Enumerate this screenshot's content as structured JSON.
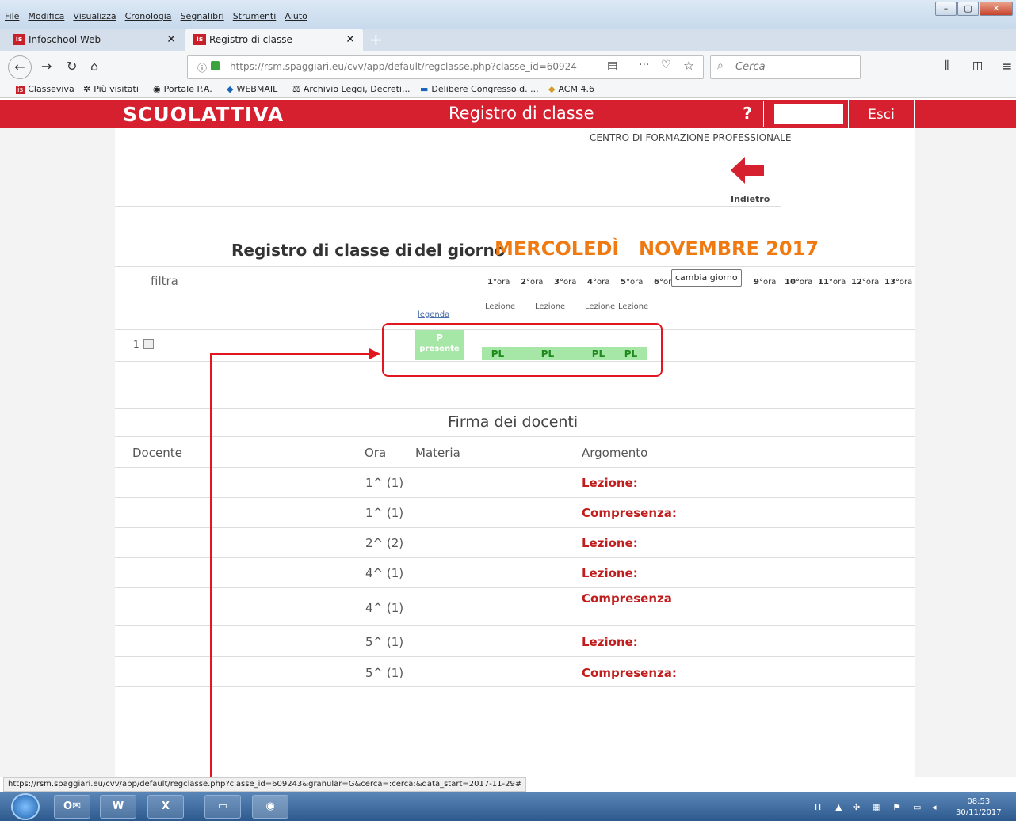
{
  "browser": {
    "menu": [
      "File",
      "Modifica",
      "Visualizza",
      "Cronologia",
      "Segnalibri",
      "Strumenti",
      "Aiuto"
    ],
    "tabs": [
      {
        "label": "Infoschool Web",
        "favicon": "is"
      },
      {
        "label": "Registro di classe",
        "favicon": "is"
      }
    ],
    "url": "https://rsm.spaggiari.eu/cvv/app/default/regclasse.php?classe_id=60924",
    "search_placeholder": "Cerca",
    "bookmarks": [
      "Classeviva",
      "Più visitati",
      "Portale P.A.",
      "WEBMAIL",
      "Archivio Leggi, Decreti...",
      "Delibere Congresso d. ...",
      "ACM 4.6"
    ],
    "status_url": "https://rsm.spaggiari.eu/cvv/app/default/regclasse.php?classe_id=609243&granular=G&cerca=:cerca:&data_start=2017-11-29#"
  },
  "header": {
    "logo": "SCUOLATTIVA",
    "title": "Registro di classe",
    "help": "?",
    "logout": "Esci"
  },
  "page": {
    "school": "CENTRO DI FORMAZIONE PROFESSIONALE",
    "back_label": "Indietro",
    "title_prefix": "Registro di classe di",
    "title_day_label": "del giorno",
    "weekday": "MERCOLEDÌ",
    "month_year": "NOVEMBRE 2017",
    "filter_label": "filtra",
    "hours": [
      {
        "n": "1°",
        "s": "ora"
      },
      {
        "n": "2°",
        "s": "ora"
      },
      {
        "n": "3°",
        "s": "ora"
      },
      {
        "n": "4°",
        "s": "ora"
      },
      {
        "n": "5°",
        "s": "ora"
      },
      {
        "n": "6°",
        "s": "or"
      },
      {
        "n": "9°",
        "s": "ora"
      },
      {
        "n": "10°",
        "s": "ora"
      },
      {
        "n": "11°",
        "s": "ora"
      },
      {
        "n": "12°",
        "s": "ora"
      },
      {
        "n": "13°",
        "s": "ora"
      }
    ],
    "tooltip": "cambia giorno",
    "lesson_labels": [
      "Lezione",
      "Lezione",
      "Lezione",
      "Lezione"
    ],
    "legend_link": "legenda",
    "student_row": {
      "number": "1",
      "presence_code": "P",
      "presence_label": "presente",
      "marks": [
        "PL",
        "PL",
        "PL",
        "PL"
      ]
    },
    "signatures": {
      "heading": "Firma dei docenti",
      "columns": [
        "Docente",
        "Ora",
        "Materia",
        "Argomento"
      ],
      "rows": [
        {
          "ora": "1^ (1)",
          "argomento": "Lezione:"
        },
        {
          "ora": "1^ (1)",
          "argomento": "Compresenza:"
        },
        {
          "ora": "2^ (2)",
          "argomento": "Lezione:"
        },
        {
          "ora": "4^ (1)",
          "argomento": "Lezione:"
        },
        {
          "ora": "4^ (1)",
          "argomento": "Compresenza"
        },
        {
          "ora": "5^ (1)",
          "argomento": "Lezione:"
        },
        {
          "ora": "5^ (1)",
          "argomento": "Compresenza:"
        }
      ]
    }
  },
  "taskbar": {
    "lang": "IT",
    "time": "08:53",
    "date": "30/11/2017",
    "apps": [
      "outlook-icon",
      "word-icon",
      "excel-icon",
      "explorer-icon",
      "firefox-icon"
    ]
  },
  "colors": {
    "brand_red": "#d7202f",
    "accent_orange": "#f07a12",
    "present_green": "#a6e6a6",
    "highlight_red": "#e0171f"
  }
}
